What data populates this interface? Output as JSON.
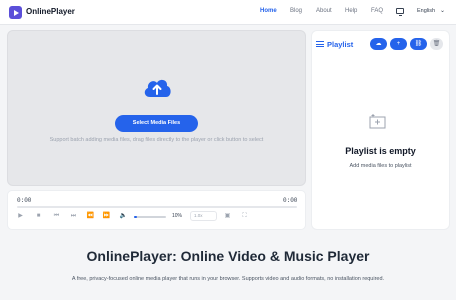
{
  "header": {
    "brand": "OnlinePlayer",
    "nav": [
      "Home",
      "Blog",
      "About",
      "Help",
      "FAQ"
    ],
    "language": "English"
  },
  "player": {
    "select_button": "Select Media Files",
    "hint": "Support batch adding media files, drag files directly to the player or click button to select",
    "current_time": "0:00",
    "duration": "0:00",
    "volume_label": "10%",
    "volume_fraction": 0.1,
    "speed_value": "1.0x"
  },
  "playlist": {
    "title": "Playlist",
    "empty_title": "Playlist is empty",
    "empty_subtitle": "Add media files to playlist"
  },
  "hero": {
    "title": "OnlinePlayer: Online Video & Music Player",
    "tagline": "A free, privacy-focused online media player that runs in your browser. Supports video and audio formats, no installation required."
  },
  "colors": {
    "accent": "#2563eb",
    "brand": "#5b4fd9"
  }
}
